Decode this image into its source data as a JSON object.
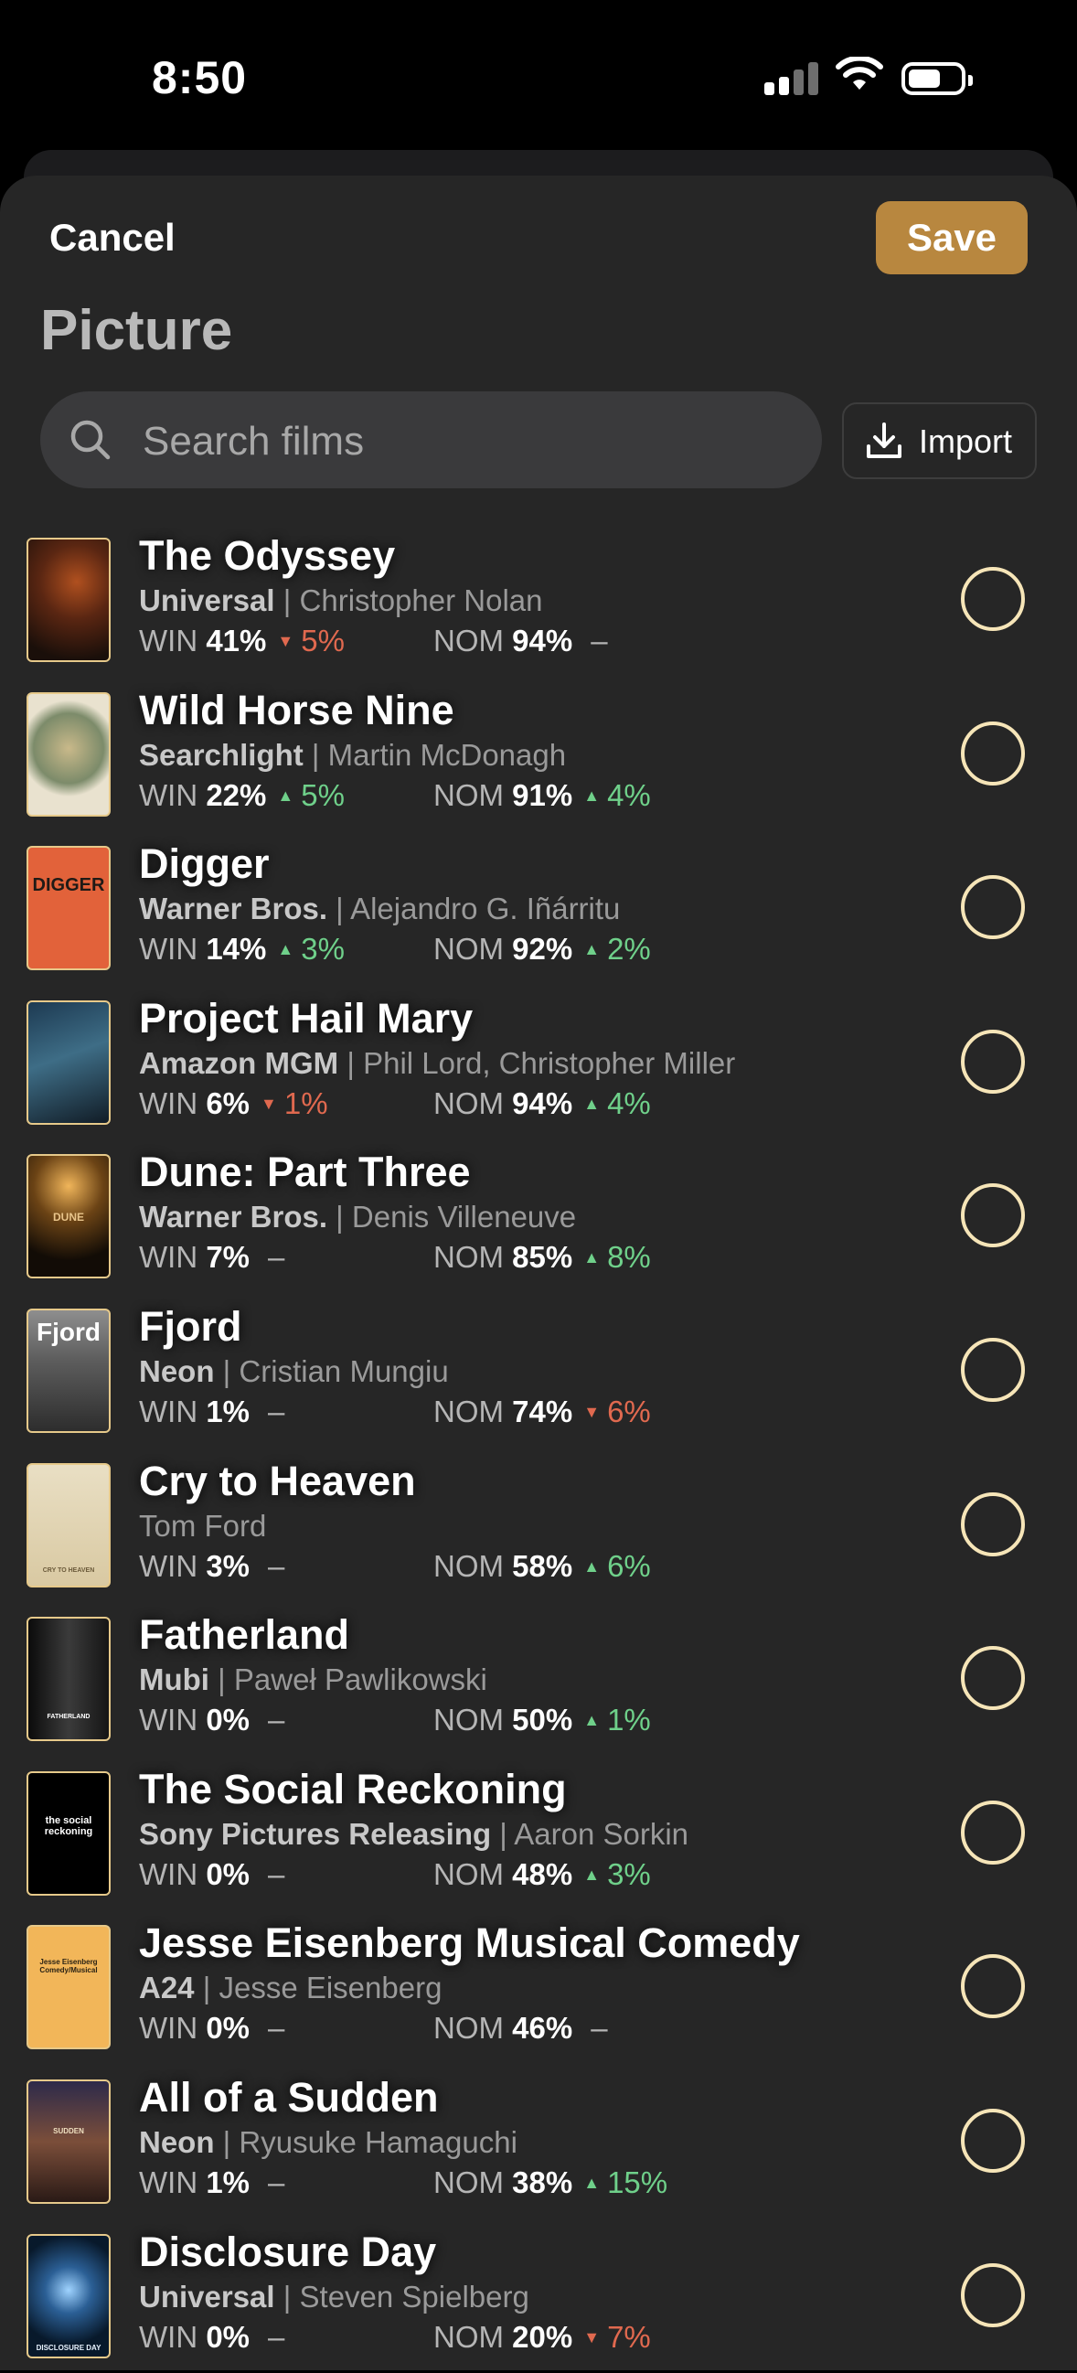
{
  "status": {
    "time": "8:50"
  },
  "header": {
    "cancel_label": "Cancel",
    "save_label": "Save",
    "title": "Picture"
  },
  "search": {
    "placeholder": "Search films"
  },
  "import": {
    "label": "Import"
  },
  "colors": {
    "accent": "#b8873f",
    "up": "#6fd08a",
    "down": "#e0694f",
    "radio": "#f6e5b8"
  },
  "films": [
    {
      "title": "The Odyssey",
      "studio": "Universal",
      "director": "Christopher Nolan",
      "win_label": "WIN",
      "win": "41%",
      "win_change": "5%",
      "win_dir": "down",
      "nom_label": "NOM",
      "nom": "94%",
      "nom_change": "",
      "nom_dir": "flat",
      "poster_text": ""
    },
    {
      "title": "Wild Horse Nine",
      "studio": "Searchlight",
      "director": "Martin McDonagh",
      "win_label": "WIN",
      "win": "22%",
      "win_change": "5%",
      "win_dir": "up",
      "nom_label": "NOM",
      "nom": "91%",
      "nom_change": "4%",
      "nom_dir": "up",
      "poster_text": ""
    },
    {
      "title": "Digger",
      "studio": "Warner Bros.",
      "director": "Alejandro G. Iñárritu",
      "win_label": "WIN",
      "win": "14%",
      "win_change": "3%",
      "win_dir": "up",
      "nom_label": "NOM",
      "nom": "92%",
      "nom_change": "2%",
      "nom_dir": "up",
      "poster_text": "DIGGER"
    },
    {
      "title": "Project Hail Mary",
      "studio": "Amazon MGM",
      "director": "Phil Lord, Christopher Miller",
      "win_label": "WIN",
      "win": "6%",
      "win_change": "1%",
      "win_dir": "down",
      "nom_label": "NOM",
      "nom": "94%",
      "nom_change": "4%",
      "nom_dir": "up",
      "poster_text": ""
    },
    {
      "title": "Dune: Part Three",
      "studio": "Warner Bros.",
      "director": "Denis Villeneuve",
      "win_label": "WIN",
      "win": "7%",
      "win_change": "",
      "win_dir": "flat",
      "nom_label": "NOM",
      "nom": "85%",
      "nom_change": "8%",
      "nom_dir": "up",
      "poster_text": "DUNE"
    },
    {
      "title": "Fjord",
      "studio": "Neon",
      "director": "Cristian Mungiu",
      "win_label": "WIN",
      "win": "1%",
      "win_change": "",
      "win_dir": "flat",
      "nom_label": "NOM",
      "nom": "74%",
      "nom_change": "6%",
      "nom_dir": "down",
      "poster_text": "Fjord"
    },
    {
      "title": "Cry to Heaven",
      "studio": "",
      "director": "Tom Ford",
      "win_label": "WIN",
      "win": "3%",
      "win_change": "",
      "win_dir": "flat",
      "nom_label": "NOM",
      "nom": "58%",
      "nom_change": "6%",
      "nom_dir": "up",
      "poster_text": "CRY TO HEAVEN"
    },
    {
      "title": "Fatherland",
      "studio": "Mubi",
      "director": "Paweł Pawlikowski",
      "win_label": "WIN",
      "win": "0%",
      "win_change": "",
      "win_dir": "flat",
      "nom_label": "NOM",
      "nom": "50%",
      "nom_change": "1%",
      "nom_dir": "up",
      "poster_text": "FATHERLAND"
    },
    {
      "title": "The Social Reckoning",
      "studio": "Sony Pictures Releasing",
      "director": "Aaron Sorkin",
      "win_label": "WIN",
      "win": "0%",
      "win_change": "",
      "win_dir": "flat",
      "nom_label": "NOM",
      "nom": "48%",
      "nom_change": "3%",
      "nom_dir": "up",
      "poster_text": "the social reckoning"
    },
    {
      "title": "Jesse Eisenberg Musical Comedy",
      "studio": "A24",
      "director": "Jesse Eisenberg",
      "win_label": "WIN",
      "win": "0%",
      "win_change": "",
      "win_dir": "flat",
      "nom_label": "NOM",
      "nom": "46%",
      "nom_change": "",
      "nom_dir": "flat",
      "poster_text": "Jesse Eisenberg Comedy/Musical"
    },
    {
      "title": "All of a Sudden",
      "studio": "Neon",
      "director": "Ryusuke Hamaguchi",
      "win_label": "WIN",
      "win": "1%",
      "win_change": "",
      "win_dir": "flat",
      "nom_label": "NOM",
      "nom": "38%",
      "nom_change": "15%",
      "nom_dir": "up",
      "poster_text": "SUDDEN"
    },
    {
      "title": "Disclosure Day",
      "studio": "Universal",
      "director": "Steven Spielberg",
      "win_label": "WIN",
      "win": "0%",
      "win_change": "",
      "win_dir": "flat",
      "nom_label": "NOM",
      "nom": "20%",
      "nom_change": "7%",
      "nom_dir": "down",
      "poster_text": "DISCLOSURE DAY"
    }
  ]
}
